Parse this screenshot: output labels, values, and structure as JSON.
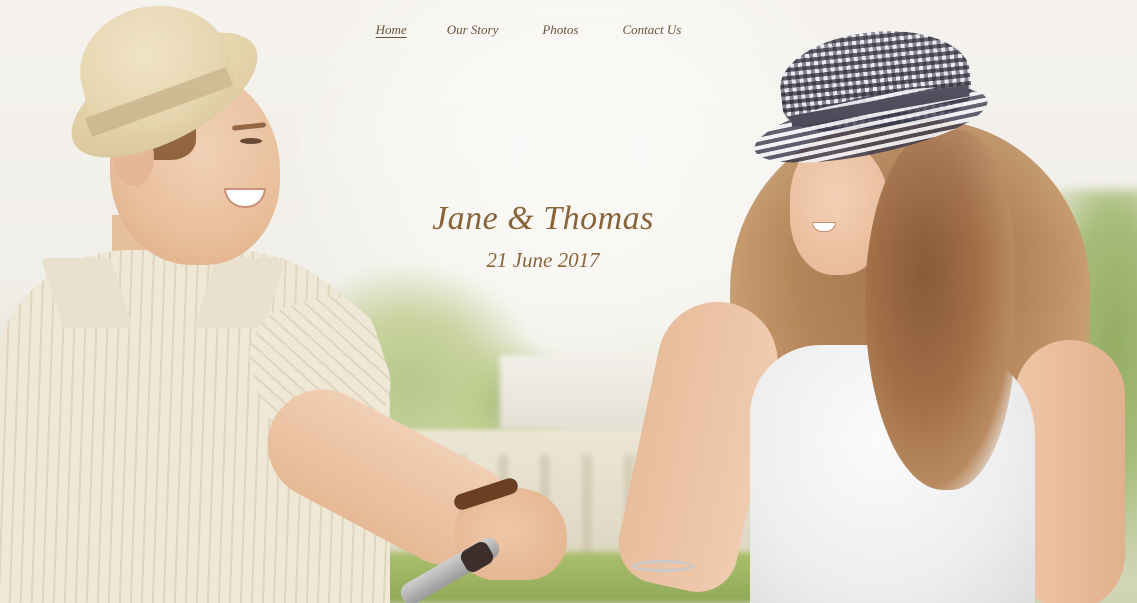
{
  "nav": {
    "items": [
      {
        "label": "Home",
        "active": true
      },
      {
        "label": "Our Story",
        "active": false
      },
      {
        "label": "Photos",
        "active": false
      },
      {
        "label": "Contact Us",
        "active": false
      }
    ]
  },
  "hero": {
    "names": "Jane & Thomas",
    "date": "21 June 2017"
  },
  "colors": {
    "text_accent": "#8a6338",
    "nav_text": "#6b5238",
    "background": "#f1efe9"
  }
}
